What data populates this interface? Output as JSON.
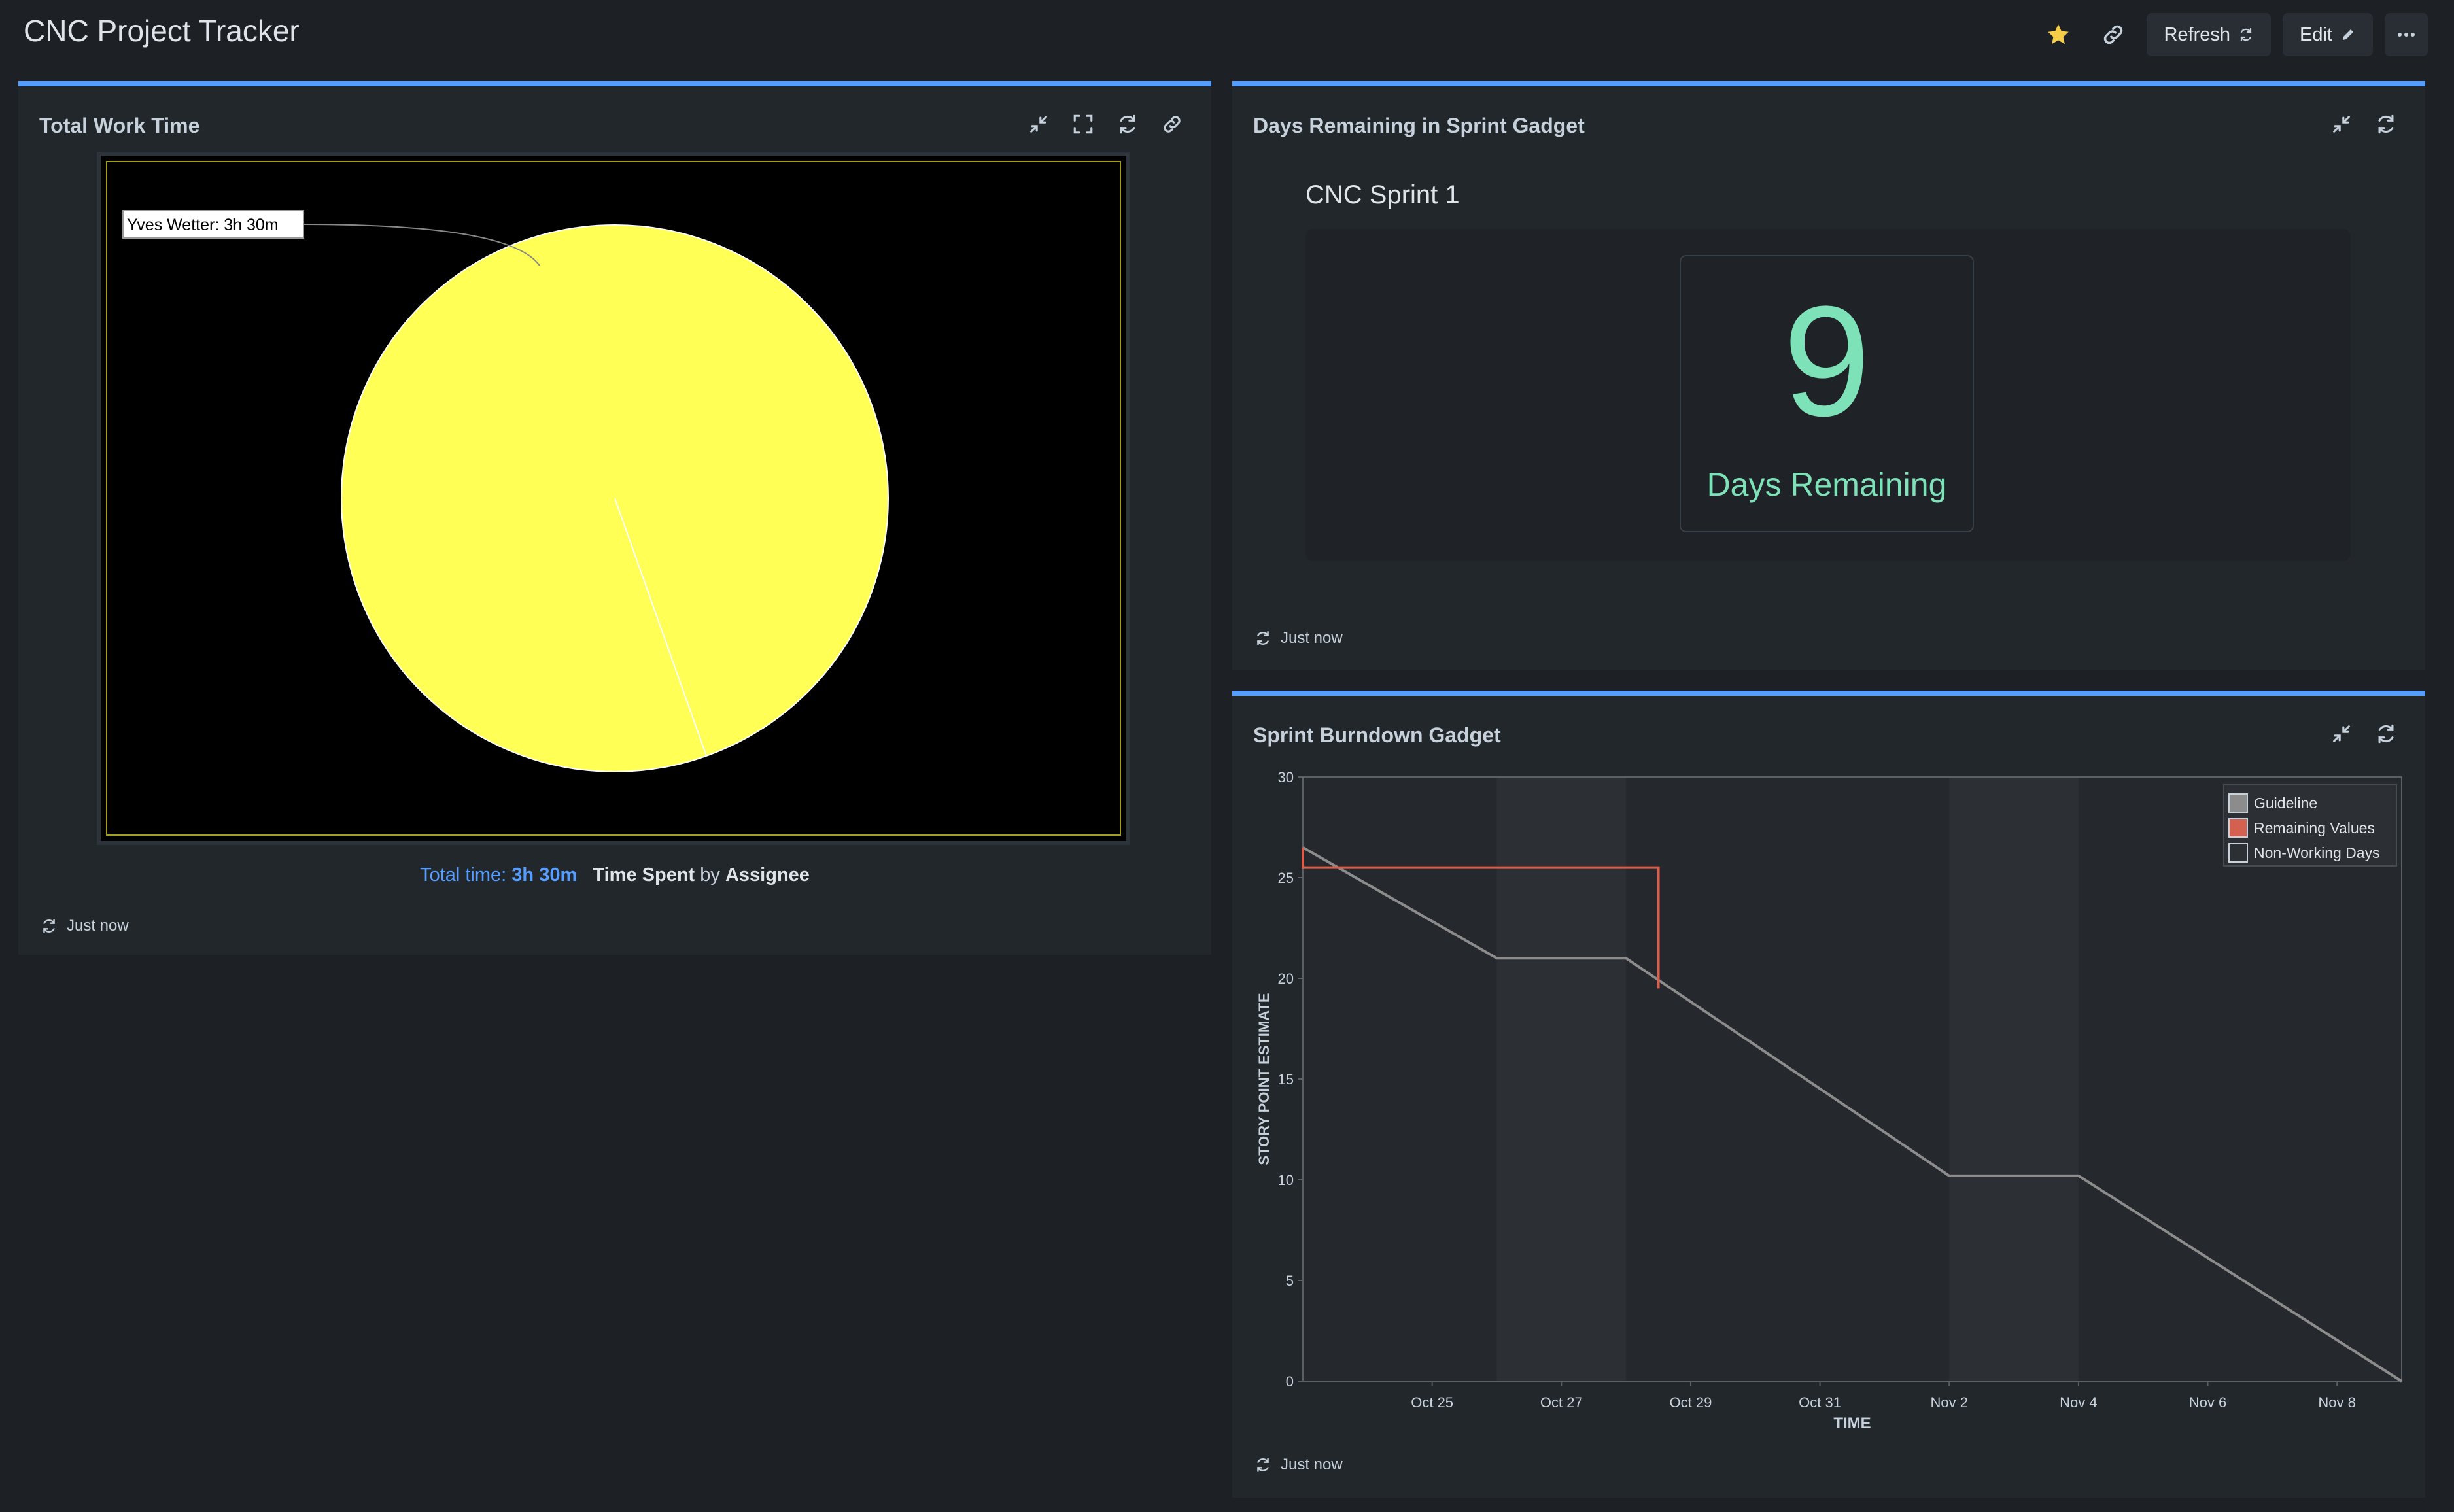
{
  "header": {
    "title": "CNC Project Tracker",
    "refresh_label": "Refresh",
    "edit_label": "Edit"
  },
  "gadgets": {
    "work_time": {
      "title": "Total Work Time",
      "caption": {
        "total_prefix": "Total time:",
        "total_value": "3h 30m",
        "metric": "Time Spent",
        "by": "by",
        "group": "Assignee"
      },
      "footer": "Just now"
    },
    "days_remaining": {
      "title": "Days Remaining in Sprint Gadget",
      "sprint": "CNC Sprint 1",
      "days": "9",
      "days_label": "Days Remaining",
      "footer": "Just now"
    },
    "burndown": {
      "title": "Sprint Burndown Gadget",
      "footer": "Just now"
    }
  },
  "chart_data": [
    {
      "type": "pie",
      "slices": [
        {
          "label": "Yves Wetter: 3h 30m",
          "value": 210,
          "color": "#ffff55"
        }
      ]
    },
    {
      "type": "line",
      "xlabel": "TIME",
      "ylabel": "STORY POINT ESTIMATE",
      "ylim": [
        0,
        30
      ],
      "yticks": [
        "0",
        "5",
        "10",
        "15",
        "20",
        "25",
        "30"
      ],
      "xlim": [
        "2023-10-23",
        "2023-11-09"
      ],
      "xticks": [
        {
          "date": "2023-10-25",
          "label": "Oct 25"
        },
        {
          "date": "2023-10-27",
          "label": "Oct 27"
        },
        {
          "date": "2023-10-29",
          "label": "Oct 29"
        },
        {
          "date": "2023-10-31",
          "label": "Oct 31"
        },
        {
          "date": "2023-11-02",
          "label": "Nov 2"
        },
        {
          "date": "2023-11-04",
          "label": "Nov 4"
        },
        {
          "date": "2023-11-06",
          "label": "Nov 6"
        },
        {
          "date": "2023-11-08",
          "label": "Nov 8"
        }
      ],
      "non_working_days": [
        [
          "2023-10-26",
          "2023-10-28"
        ],
        [
          "2023-11-02",
          "2023-11-04"
        ]
      ],
      "series": [
        {
          "name": "Guideline",
          "color": "#8c8c8c",
          "points": [
            [
              "2023-10-23",
              26.5
            ],
            [
              "2023-10-26",
              21
            ],
            [
              "2023-10-28",
              21
            ],
            [
              "2023-11-02",
              10.2
            ],
            [
              "2023-11-04",
              10.2
            ],
            [
              "2023-11-09",
              0
            ]
          ]
        },
        {
          "name": "Remaining Values",
          "color": "#d4614f",
          "points": [
            [
              "2023-10-23",
              26.5
            ],
            [
              "2023-10-23",
              25.5
            ],
            [
              "2023-10-28.5",
              25.5
            ],
            [
              "2023-10-28.5",
              19.5
            ]
          ]
        }
      ],
      "legend": [
        "Guideline",
        "Remaining Values",
        "Non-Working Days"
      ],
      "legend_position": "top-right"
    }
  ]
}
